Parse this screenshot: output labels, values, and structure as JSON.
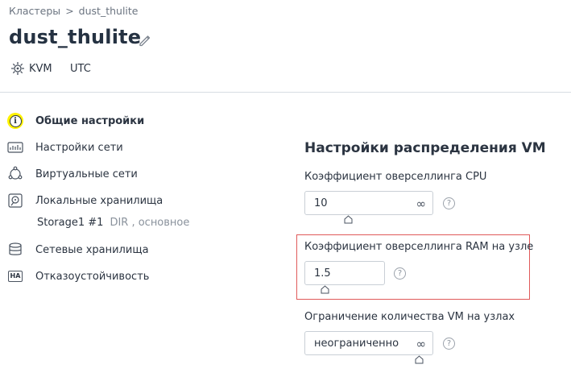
{
  "breadcrumb": {
    "parent": "Кластеры",
    "separator": ">",
    "current": "dust_thulite"
  },
  "page_title": "dust_thulite",
  "meta": {
    "hypervisor": "KVM",
    "timezone": "UTC"
  },
  "nav": {
    "items": [
      {
        "label": "Общие настройки",
        "icon": "info-icon"
      },
      {
        "label": "Настройки сети",
        "icon": "network-icon"
      },
      {
        "label": "Виртуальные сети",
        "icon": "virtual-network-icon"
      },
      {
        "label": "Локальные хранилища",
        "icon": "local-storage-icon"
      },
      {
        "label": "Сетевые хранилища",
        "icon": "network-storage-icon"
      },
      {
        "label": "Отказоустойчивость",
        "icon": "ha-icon"
      }
    ],
    "sub_item": {
      "name": "Storage1 #1",
      "details": "DIR , основное"
    },
    "ha_badge": "HA",
    "active_color": "#fff200"
  },
  "vm_distribution": {
    "title": "Настройки распределения VM",
    "cpu": {
      "label": "Коэффициент оверселлинга CPU",
      "value": "10",
      "suffix": "∞"
    },
    "ram": {
      "label": "Коэффициент оверселлинга RAM на узле",
      "value": "1.5"
    },
    "vm_limit": {
      "label": "Ограничение количества VM на узлах",
      "value": "неограниченно",
      "suffix": "∞"
    },
    "help_symbol": "?"
  },
  "colors": {
    "highlight": "#e05a5a",
    "text": "#2b3441"
  }
}
